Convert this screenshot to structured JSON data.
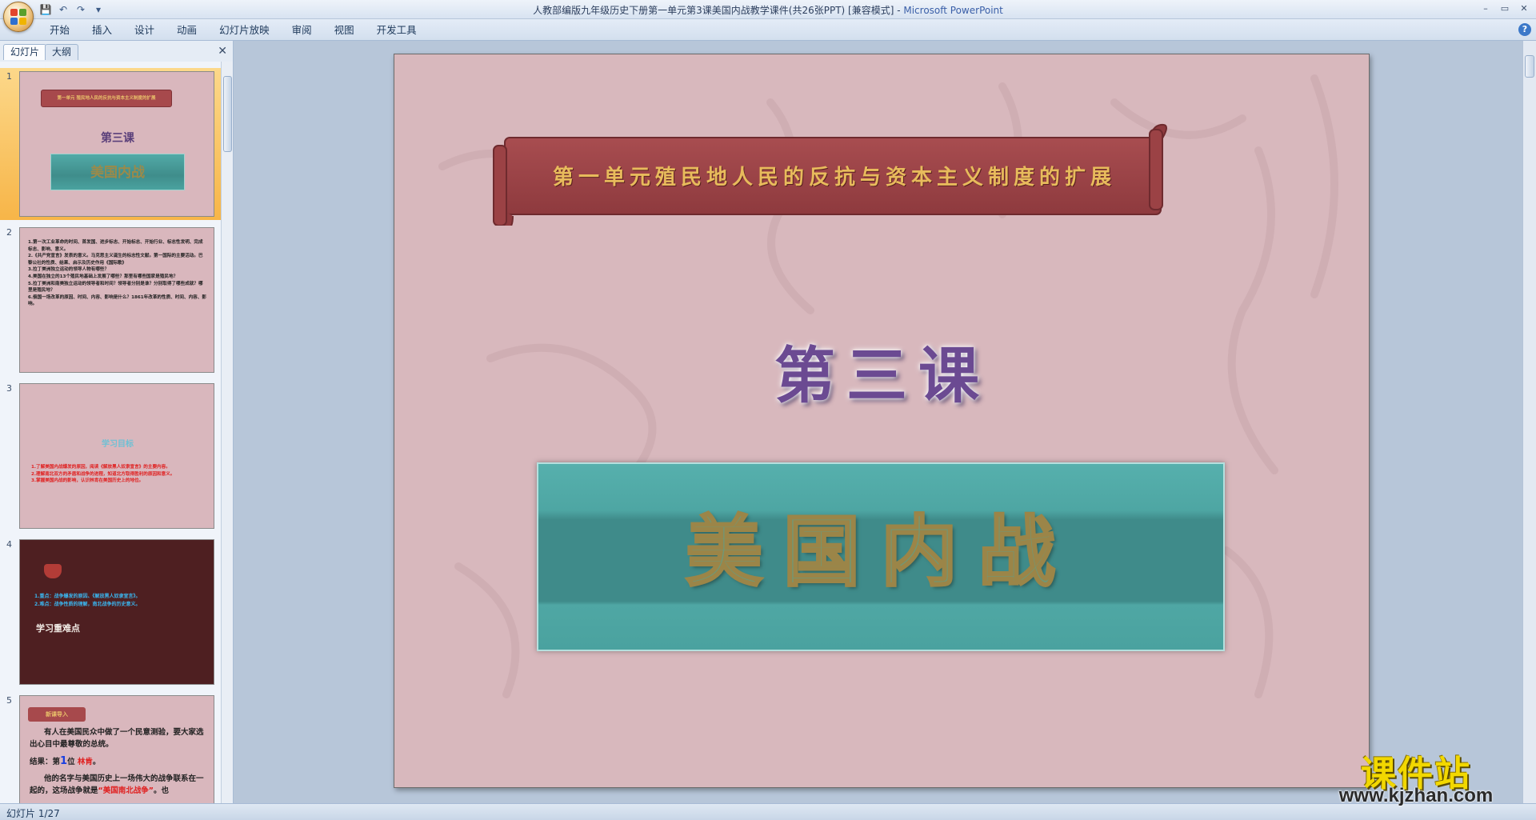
{
  "window": {
    "title": "人教部编版九年级历史下册第一单元第3课美国内战教学课件(共26张PPT) [兼容模式] - ",
    "app_name": "Microsoft PowerPoint",
    "minimize": "–",
    "restore": "▭",
    "close": "✕"
  },
  "qat": {
    "save": "💾",
    "undo": "↶",
    "redo": "↷",
    "more": "▾"
  },
  "ribbon": {
    "tabs": [
      "开始",
      "插入",
      "设计",
      "动画",
      "幻灯片放映",
      "审阅",
      "视图",
      "开发工具"
    ],
    "help": "?"
  },
  "pane": {
    "tabs": {
      "slides": "幻灯片",
      "outline": "大纲"
    },
    "close": "✕",
    "thumbnails": [
      {
        "number": "1",
        "banner": "第一单元 殖民地人民的反抗与资本主义制度的扩展",
        "lesson": "第三课",
        "title": "美国内战"
      },
      {
        "number": "2",
        "lines": [
          "1.第一次工业革命的时间、首发国、进步标志、开始标志、开始行业、标志性发明、完成标志、影响、意义。",
          "2.《共产党宣言》发表的意义。马克思主义诞生的标志性文献。第一国际的主要活动。巴黎公社的性质、结果、启示及历史作用《国际歌》",
          "3.拉丁美洲独立运动的领导人物有哪些？",
          "4.美国在独立的13个殖民地基础上发展了哪些？那里有哪些国家是殖民地？",
          "5.拉丁美洲和南美独立运动的领导者和时间？领导者分别是谁？分别取得了哪些成就？哪里是殖民地？",
          "6.俄国一场改革的原因、时间、内容、影响是什么？1861年改革的性质、时间、内容、影响。"
        ]
      },
      {
        "number": "3",
        "heading": "学习目标",
        "lines": [
          "1.了解美国内战爆发的原因，阅读《解放黑人奴隶宣言》的主要内容。",
          "2.理解南北双方的矛盾和战争的进程，知道北方取得胜利的原因和意义。",
          "3.掌握美国内战的影响，认识林肯在美国历史上的地位。"
        ]
      },
      {
        "number": "4",
        "lines": [
          "1.重点：战争爆发的原因、《解放黑人奴隶宣言》。",
          "2.难点：战争性质的理解，南北战争的历史意义。"
        ],
        "heading": "学习重难点"
      },
      {
        "number": "5",
        "banner": "新课导入",
        "para1": "有人在美国民众中做了一个民意测验，要大家选出心目中最尊敬的总统。",
        "result_label": "结果：第",
        "result_rank": "1",
        "result_mid": "位",
        "result_name": "林肯",
        "result_end": "。",
        "para2_start": "他的名字与美国历史上一场伟大的战争联系在一起的，这场战争就是",
        "para2_war": "“美国南北战争”",
        "para2_end": "。也"
      }
    ]
  },
  "slide": {
    "banner": "第一单元殖民地人民的反抗与资本主义制度的扩展",
    "lesson": "第三课",
    "title": "美国内战"
  },
  "status": {
    "slide_counter": "幻灯片 1/27"
  },
  "watermark": {
    "name": "课件站",
    "url": "www.kjzhan.com"
  }
}
